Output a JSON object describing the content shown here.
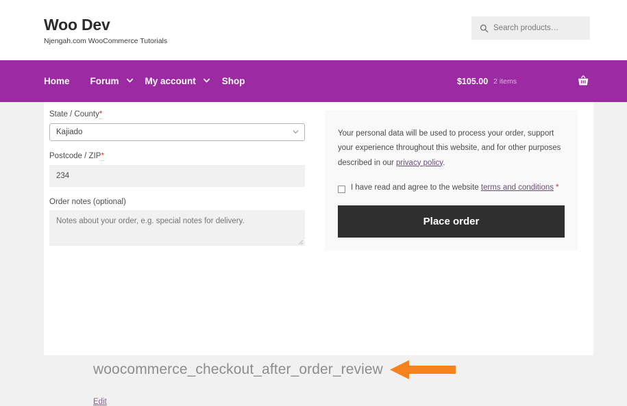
{
  "header": {
    "site_title": "Woo Dev",
    "tagline": "Njengah.com WooCommerce Tutorials",
    "search": {
      "placeholder": "Search products…",
      "value": "",
      "icon": "search-icon"
    }
  },
  "nav": {
    "brand_color": "#9c2ba3",
    "items": [
      {
        "label": "Home",
        "has_submenu": false
      },
      {
        "label": "Forum",
        "has_submenu": true
      },
      {
        "label": "My account",
        "has_submenu": true
      },
      {
        "label": "Shop",
        "has_submenu": false
      }
    ],
    "cart": {
      "amount": "$105.00",
      "count": "2 items",
      "icon": "shopping-basket-icon"
    }
  },
  "checkout": {
    "state_field": {
      "label": "State / County",
      "required_mark": "*",
      "value": "Kajiado"
    },
    "postcode_field": {
      "label": "Postcode / ZIP",
      "required_mark": "*",
      "value": "234"
    },
    "notes_field": {
      "label": "Order notes (optional)",
      "placeholder": "Notes about your order, e.g. special notes for delivery.",
      "value": ""
    }
  },
  "order_review": {
    "privacy_prefix": "Your personal data will be used to process your order, support your experience throughout this website, and for other purposes described in our ",
    "privacy_link": "privacy policy",
    "privacy_suffix": ".",
    "terms_prefix": "I have read and agree to the website ",
    "terms_link": "terms and conditions",
    "terms_required": "*",
    "checkbox_checked": false,
    "place_order_label": "Place order",
    "button_color": "#2f2f2f"
  },
  "annotation": {
    "hook_name": "woocommerce_checkout_after_order_review",
    "arrow_color": "#f5821f",
    "arrow_direction": "left",
    "edit_label": "Edit"
  }
}
